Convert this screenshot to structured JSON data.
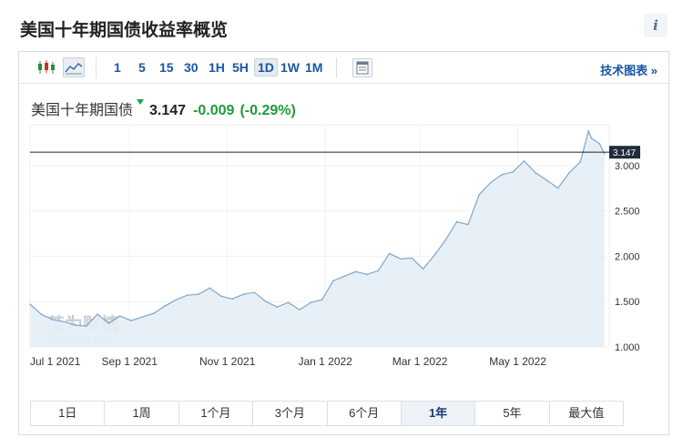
{
  "header": {
    "title": "美国十年期国债收益率概览",
    "info_label": "i"
  },
  "toolbar": {
    "ranges": [
      "1",
      "5",
      "15",
      "30",
      "1H",
      "5H",
      "1D",
      "1W",
      "1M"
    ],
    "active_range": "1D",
    "tech_chart_link": "技术图表 »"
  },
  "quote": {
    "name": "美国十年期国债",
    "price": "3.147",
    "change": "-0.009",
    "change_pct": "(-0.29%)"
  },
  "watermark": {
    "line1": "英为财情",
    "line2": "Investing.com"
  },
  "colors": {
    "line": "#7fa6cc",
    "fill": "#e6eef6",
    "up_green": "#1f9a3a",
    "link_blue": "#1a56a5",
    "price_tag": "#1f2d3d"
  },
  "chart_data": {
    "type": "area",
    "x": [
      "2021-07-01",
      "2021-07-08",
      "2021-07-15",
      "2021-07-22",
      "2021-07-29",
      "2021-08-05",
      "2021-08-12",
      "2021-08-19",
      "2021-08-26",
      "2021-09-02",
      "2021-09-09",
      "2021-09-16",
      "2021-09-23",
      "2021-09-30",
      "2021-10-07",
      "2021-10-14",
      "2021-10-21",
      "2021-10-28",
      "2021-11-04",
      "2021-11-11",
      "2021-11-18",
      "2021-11-25",
      "2021-12-02",
      "2021-12-09",
      "2021-12-16",
      "2021-12-23",
      "2021-12-30",
      "2022-01-06",
      "2022-01-13",
      "2022-01-20",
      "2022-01-27",
      "2022-02-03",
      "2022-02-10",
      "2022-02-17",
      "2022-02-24",
      "2022-03-03",
      "2022-03-10",
      "2022-03-17",
      "2022-03-24",
      "2022-03-31",
      "2022-04-07",
      "2022-04-14",
      "2022-04-21",
      "2022-04-28",
      "2022-05-05",
      "2022-05-12",
      "2022-05-19",
      "2022-05-26",
      "2022-06-02",
      "2022-06-09",
      "2022-06-14",
      "2022-06-16",
      "2022-06-21",
      "2022-06-24"
    ],
    "y": [
      1.47,
      1.36,
      1.3,
      1.28,
      1.24,
      1.23,
      1.36,
      1.26,
      1.34,
      1.29,
      1.33,
      1.37,
      1.45,
      1.52,
      1.57,
      1.58,
      1.65,
      1.56,
      1.53,
      1.58,
      1.6,
      1.5,
      1.44,
      1.49,
      1.41,
      1.49,
      1.52,
      1.73,
      1.78,
      1.83,
      1.8,
      1.84,
      2.03,
      1.97,
      1.98,
      1.86,
      2.01,
      2.18,
      2.38,
      2.35,
      2.68,
      2.81,
      2.9,
      2.93,
      3.05,
      2.92,
      2.84,
      2.75,
      2.92,
      3.04,
      3.38,
      3.3,
      3.24,
      3.13
    ],
    "current_value": 3.147,
    "x_tick_labels": [
      "Jul 1 2021",
      "Sep 1 2021",
      "Nov 1 2021",
      "Jan 1 2022",
      "Mar 1 2022",
      "May 1 2022"
    ],
    "x_tick_dates": [
      "2021-07-01",
      "2021-09-01",
      "2021-11-01",
      "2022-01-01",
      "2022-03-01",
      "2022-05-01"
    ],
    "y_tick_labels": [
      "1.000",
      "1.500",
      "2.000",
      "2.500",
      "3.000"
    ],
    "y_ticks": [
      1.0,
      1.5,
      2.0,
      2.5,
      3.0
    ],
    "ylim": [
      1.0,
      3.45
    ],
    "xlim": [
      "2021-07-01",
      "2022-06-27"
    ],
    "grid": true
  },
  "period_buttons": [
    "1日",
    "1周",
    "1个月",
    "3个月",
    "6个月",
    "1年",
    "5年",
    "最大值"
  ],
  "active_period": "1年"
}
